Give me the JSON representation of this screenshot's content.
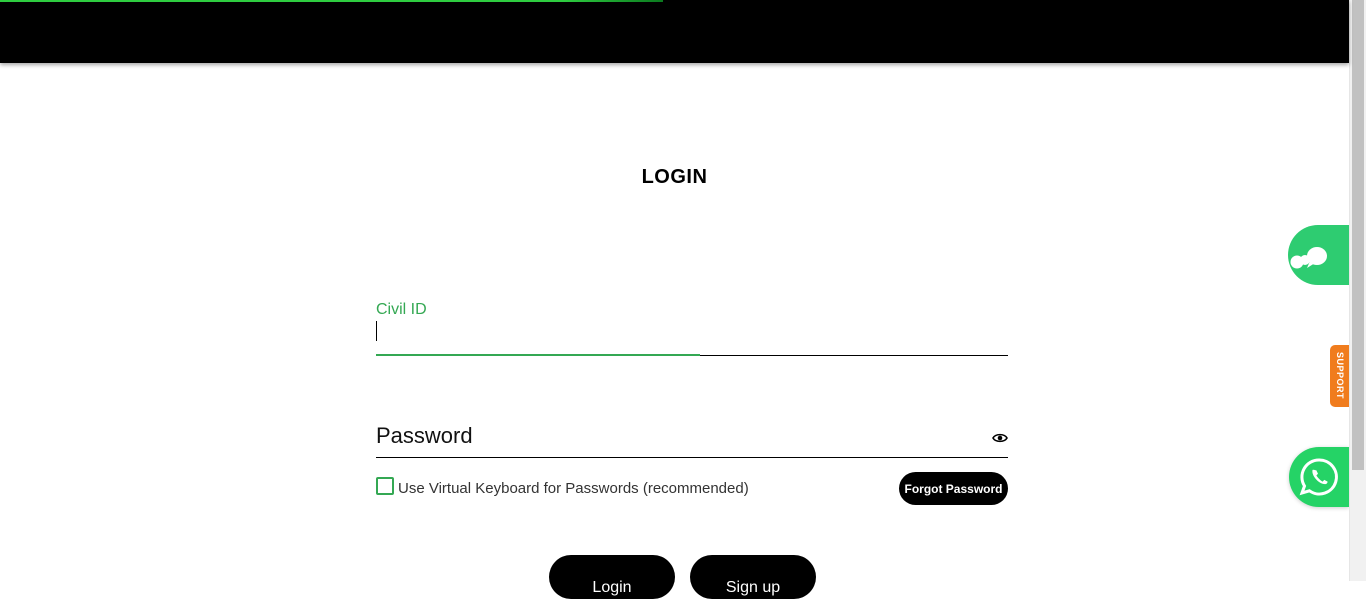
{
  "header": {
    "progress": 0.485
  },
  "page": {
    "title": "LOGIN"
  },
  "civil_id": {
    "label": "Civil ID",
    "value": ""
  },
  "password": {
    "placeholder": "Password",
    "value": ""
  },
  "virtual_keyboard": {
    "label": "Use Virtual Keyboard for Passwords (recommended)",
    "checked": false
  },
  "buttons": {
    "forgot_password": "Forgot Password",
    "login": "Login",
    "signup": "Sign up"
  },
  "widgets": {
    "chat_icon": "chat-bubbles-icon",
    "support_label": "SUPPORT",
    "whatsapp_icon": "whatsapp-icon"
  },
  "colors": {
    "accent": "#34a853",
    "header_bg": "#000000",
    "chat_bg": "#2ecc71",
    "support_bg": "#f07c1d",
    "whatsapp_bg": "#25d366"
  }
}
